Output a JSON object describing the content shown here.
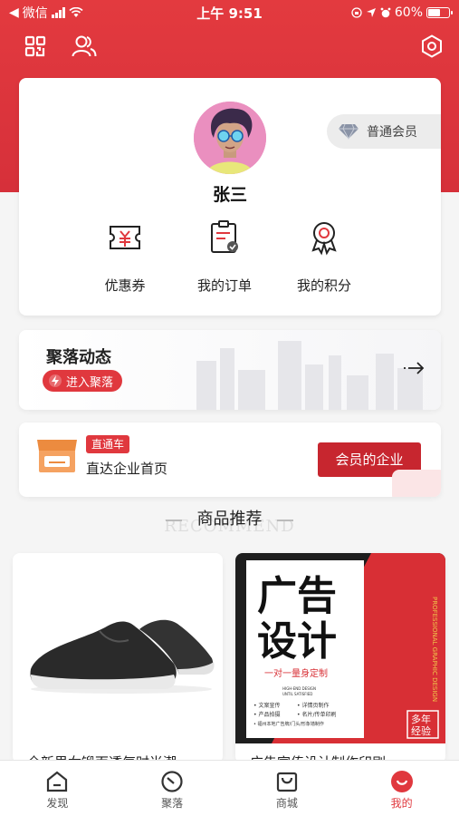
{
  "status_bar": {
    "carrier": "微信",
    "time": "上午 9:51",
    "battery": "60%",
    "battery_level": 0.6
  },
  "profile": {
    "member_level": "普通会员",
    "user_name": "张三",
    "quick_actions": [
      {
        "label": "优惠券",
        "icon": "coupon-icon"
      },
      {
        "label": "我的订单",
        "icon": "order-icon"
      },
      {
        "label": "我的积分",
        "icon": "points-icon"
      }
    ]
  },
  "community": {
    "title": "聚落动态",
    "enter_label": "进入聚落"
  },
  "direct": {
    "tag": "直通车",
    "text": "直达企业首页",
    "button": "会员的企业"
  },
  "recommend": {
    "title": "商品推荐",
    "watermark": "RECOMMEND"
  },
  "products": [
    {
      "name": "全新男女锻面透气时尚潮",
      "image": "black-sneaker"
    },
    {
      "name": "广告宣传设计制作印刷",
      "image": "ad-design-poster",
      "poster": {
        "line1": "广告",
        "line2": "设计",
        "subtitle": "一对一量身定制",
        "slogan1": "HIGH-END DESIGN",
        "slogan2": "UNTIL SATISFIED",
        "services": [
          "• 文案宣传",
          "• 详情页制作",
          "• 产品拍摄",
          "• 名片/传单印刷",
          "• 福州本地广告牌/门头/形象墙制作"
        ],
        "side_text": "PROFESSIONAL GRAPHIC DESIGN",
        "stamp1": "多年",
        "stamp2": "经验"
      }
    }
  ],
  "tabbar": [
    {
      "label": "发现",
      "icon": "discover-icon",
      "active": false
    },
    {
      "label": "聚落",
      "icon": "community-icon",
      "active": false
    },
    {
      "label": "商城",
      "icon": "mall-icon",
      "active": false
    },
    {
      "label": "我的",
      "icon": "me-icon",
      "active": true
    }
  ],
  "colors": {
    "brand_red": "#e0383e",
    "dark_red": "#c7262f"
  }
}
